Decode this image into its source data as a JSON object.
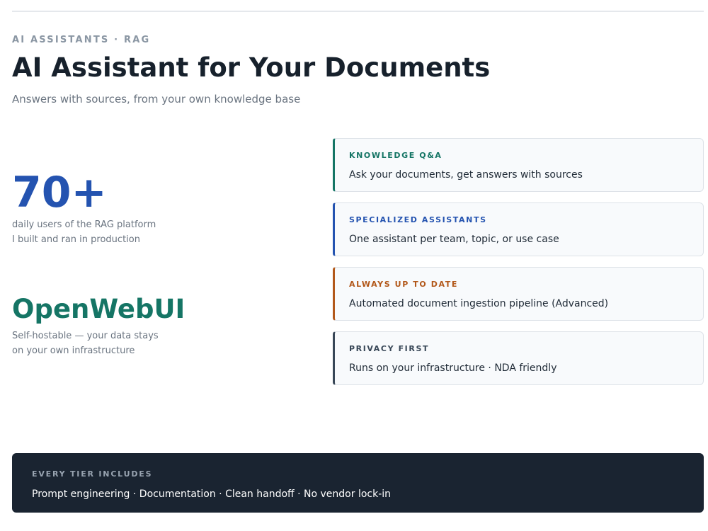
{
  "header": {
    "eyebrow": "AI ASSISTANTS · RAG",
    "title": "AI Assistant for Your Documents",
    "subtitle": "Answers with sources, from your own knowledge base"
  },
  "stats": [
    {
      "value": "70+",
      "caption_line1": "daily users of the RAG platform",
      "caption_line2": "I built and ran in production",
      "color": "#2453b0"
    },
    {
      "value": "OpenWebUI",
      "caption_line1": "Self-hostable — your data stays",
      "caption_line2": "on your own infrastructure",
      "color": "#157565"
    }
  ],
  "features": [
    {
      "label": "KNOWLEDGE Q&A",
      "text": "Ask your documents, get answers with sources",
      "color": "#157565"
    },
    {
      "label": "SPECIALIZED ASSISTANTS",
      "text": "One assistant per team, topic, or use case",
      "color": "#2453b0"
    },
    {
      "label": "ALWAYS UP TO DATE",
      "text": "Automated document ingestion pipeline (Advanced)",
      "color": "#b2581a"
    },
    {
      "label": "PRIVACY FIRST",
      "text": "Runs on your infrastructure · NDA friendly",
      "color": "#384757"
    }
  ],
  "footer": {
    "label": "EVERY TIER INCLUDES",
    "text": "Prompt engineering · Documentation · Clean handoff · No vendor lock-in"
  }
}
